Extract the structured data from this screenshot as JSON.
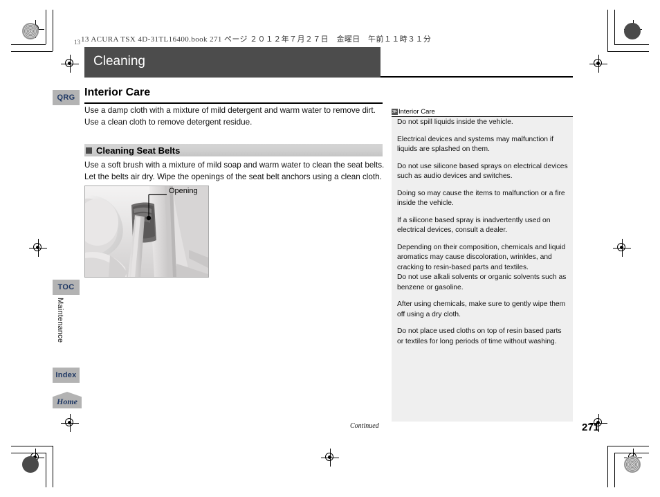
{
  "print_header": "13 ACURA TSX 4D-31TL16400.book  271 ページ  ２０１２年７月２７日　金曜日　午前１１時３１分",
  "corner_label": "13",
  "chapter": {
    "title": "Cleaning"
  },
  "tabs": {
    "qrg": "QRG",
    "toc": "TOC",
    "index": "Index",
    "home": "Home",
    "chapter_vertical": "Maintenance"
  },
  "main": {
    "heading": "Interior Care",
    "intro": "Use a damp cloth with a mixture of mild detergent and warm water to remove dirt. Use a clean cloth to remove detergent residue.",
    "section_heading": "Cleaning Seat Belts",
    "section_body": "Use a soft brush with a mixture of mild soap and warm water to clean the seat belts. Let the belts air dry. Wipe the openings of the seat belt anchors using a clean cloth.",
    "figure_callout": "Opening"
  },
  "note_panel": {
    "title": "Interior Care",
    "marker": "≫",
    "paragraphs": [
      "Do not spill liquids inside the vehicle.",
      "Electrical devices and systems may malfunction if liquids are splashed on them.",
      "Do not use silicone based sprays on electrical devices such as audio devices and switches.",
      "Doing so may cause the items to malfunction or a fire inside the vehicle.",
      "If a silicone based spray is inadvertently used on electrical devices, consult a dealer.",
      "Depending on their composition, chemicals and liquid aromatics may cause discoloration, wrinkles, and cracking to resin-based parts and textiles.",
      "Do not use alkali solvents or organic solvents such as benzene or gasoline.",
      "After using chemicals, make sure to gently wipe them off using a dry cloth.",
      "Do not place used cloths on top of resin based parts or textiles for long periods of time without washing."
    ]
  },
  "footer": {
    "continued": "Continued",
    "page_number": "271"
  },
  "colors": {
    "title_bar": "#4c4c4c",
    "tab_bg": "#b3b3b3",
    "tab_text": "#1f3864",
    "note_bg": "#efefef",
    "section_head_bg": "#cfcfcf"
  }
}
